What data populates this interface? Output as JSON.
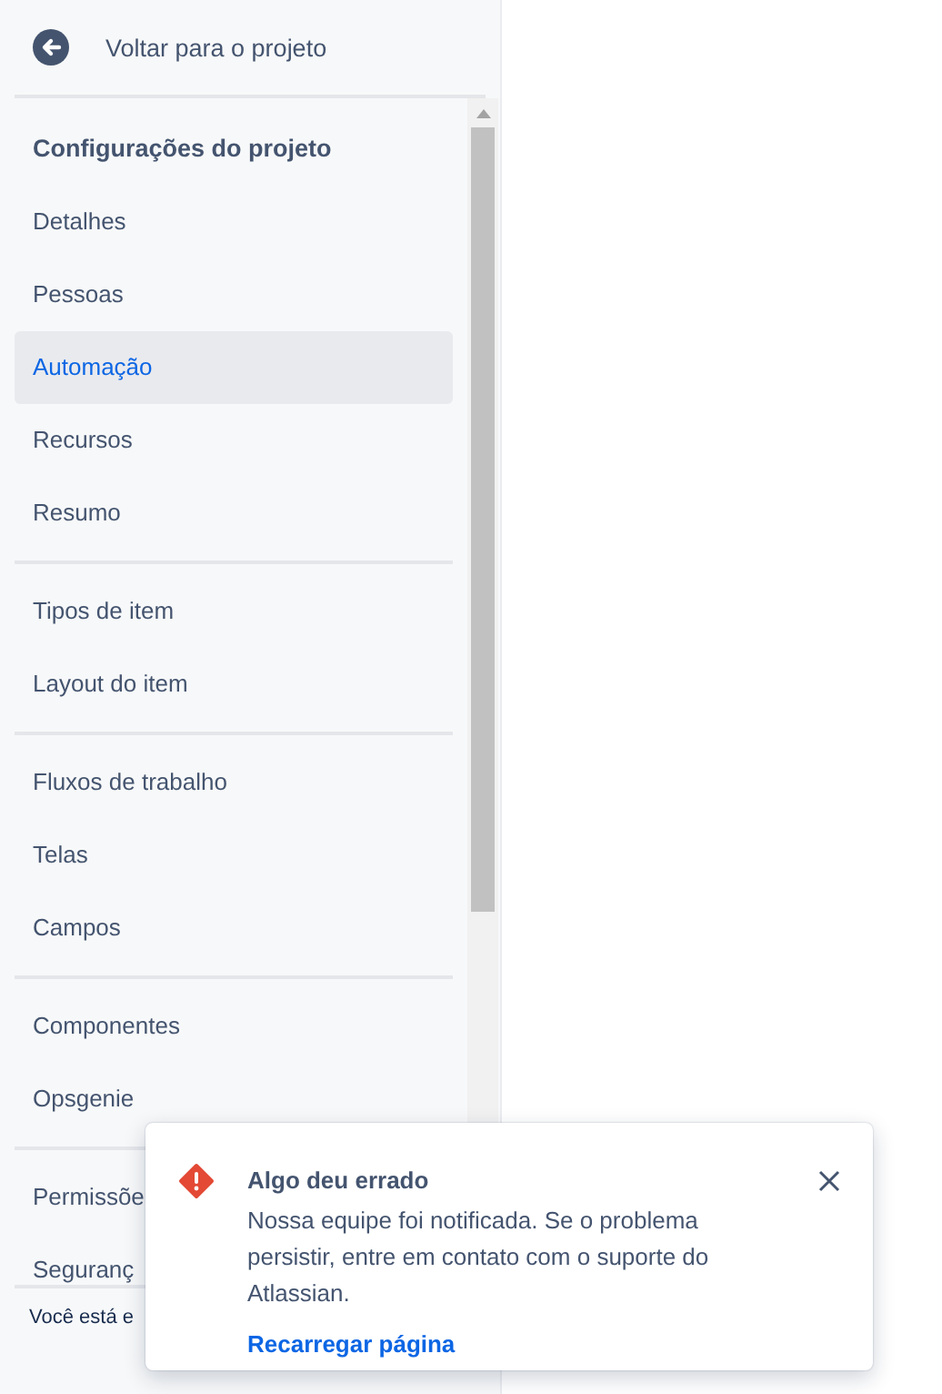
{
  "back_link": {
    "label": "Voltar para o projeto"
  },
  "sidebar": {
    "heading": "Configurações do projeto",
    "groups": [
      {
        "items": [
          {
            "label": "Detalhes",
            "selected": false
          },
          {
            "label": "Pessoas",
            "selected": false
          },
          {
            "label": "Automação",
            "selected": true
          },
          {
            "label": "Recursos",
            "selected": false
          },
          {
            "label": "Resumo",
            "selected": false
          }
        ]
      },
      {
        "items": [
          {
            "label": "Tipos de item",
            "selected": false
          },
          {
            "label": "Layout do item",
            "selected": false
          }
        ]
      },
      {
        "items": [
          {
            "label": "Fluxos de trabalho",
            "selected": false
          },
          {
            "label": "Telas",
            "selected": false
          },
          {
            "label": "Campos",
            "selected": false
          }
        ]
      },
      {
        "items": [
          {
            "label": "Componentes",
            "selected": false
          },
          {
            "label": "Opsgenie",
            "selected": false
          }
        ]
      },
      {
        "items": [
          {
            "label": "Permissõe",
            "selected": false
          },
          {
            "label": "Seguranç",
            "selected": false
          }
        ]
      }
    ]
  },
  "footer": {
    "text": "Você está e"
  },
  "toast": {
    "title": "Algo deu errado",
    "message": "Nossa equipe foi notificada. Se o problema persistir, entre em contato com o suporte do Atlassian.",
    "action": "Recarregar página"
  }
}
